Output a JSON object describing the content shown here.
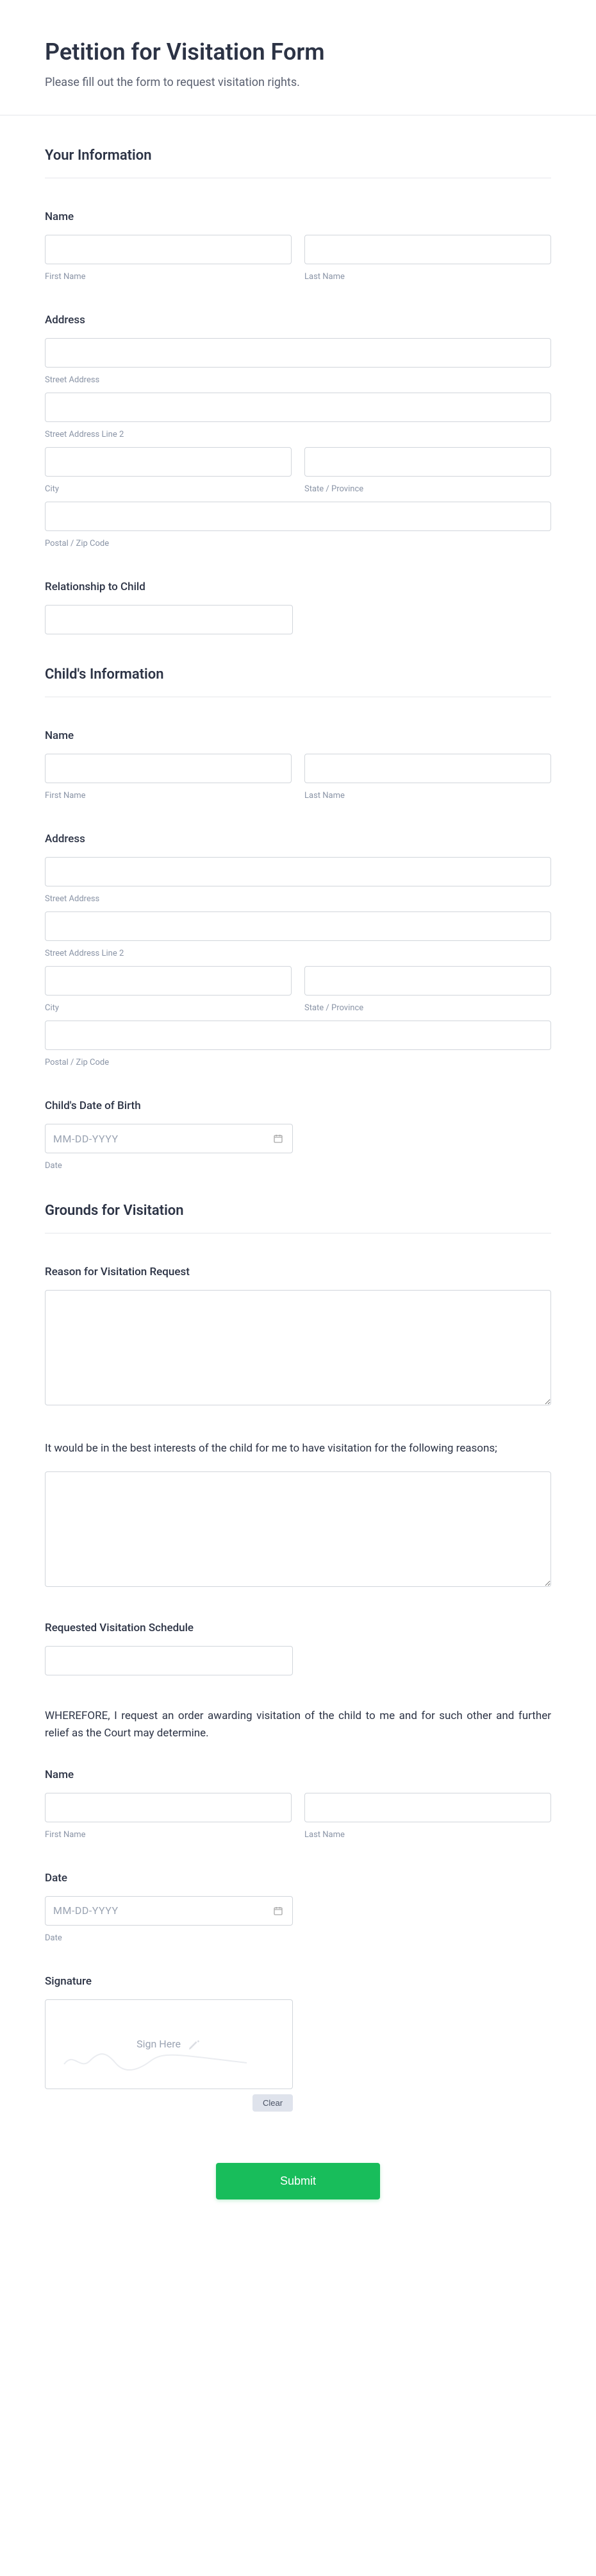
{
  "header": {
    "title": "Petition for Visitation Form",
    "subtitle": "Please fill out the form to request visitation rights."
  },
  "sections": {
    "your_info": "Your Information",
    "child_info": "Child's Information",
    "grounds": "Grounds for Visitation"
  },
  "labels": {
    "name": "Name",
    "address": "Address",
    "relationship": "Relationship to Child",
    "dob": "Child's Date of Birth",
    "reason": "Reason for Visitation Request",
    "best_interest": "It would be in the best interests of the child for me to have visitation for the following reasons;",
    "schedule": "Requested Visitation Schedule",
    "wherefore": "WHEREFORE, I request an order awarding visitation of the child to me and for such other and further relief as the Court may determine.",
    "date": "Date",
    "signature": "Signature",
    "sign_here": "Sign Here",
    "clear": "Clear",
    "submit": "Submit"
  },
  "sublabels": {
    "first_name": "First Name",
    "last_name": "Last Name",
    "street": "Street Address",
    "street2": "Street Address Line 2",
    "city": "City",
    "state": "State / Province",
    "postal": "Postal / Zip Code",
    "date": "Date"
  },
  "placeholders": {
    "date": "MM-DD-YYYY"
  }
}
